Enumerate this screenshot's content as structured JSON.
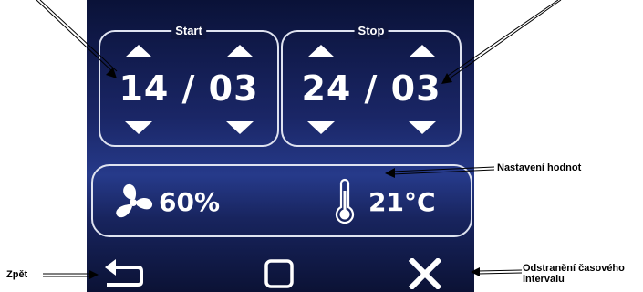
{
  "start": {
    "title": "Start",
    "value": "14 / 03"
  },
  "stop": {
    "title": "Stop",
    "value": "24 / 03"
  },
  "values": {
    "fan": {
      "icon": "fan-icon",
      "value": "60%"
    },
    "temperature": {
      "icon": "thermometer-icon",
      "value": "21°C"
    }
  },
  "nav": {
    "back_icon": "back-arrow-icon",
    "home_icon": "square-icon",
    "close_icon": "close-icon"
  },
  "annotations": {
    "values_setting": "Nastavení hodnot",
    "back": "Zpět",
    "remove_interval": "Odstranění časového intervalu"
  },
  "colors": {
    "screen_bg": "#1a2666",
    "foreground": "#ffffff",
    "annotation": "#000000"
  }
}
